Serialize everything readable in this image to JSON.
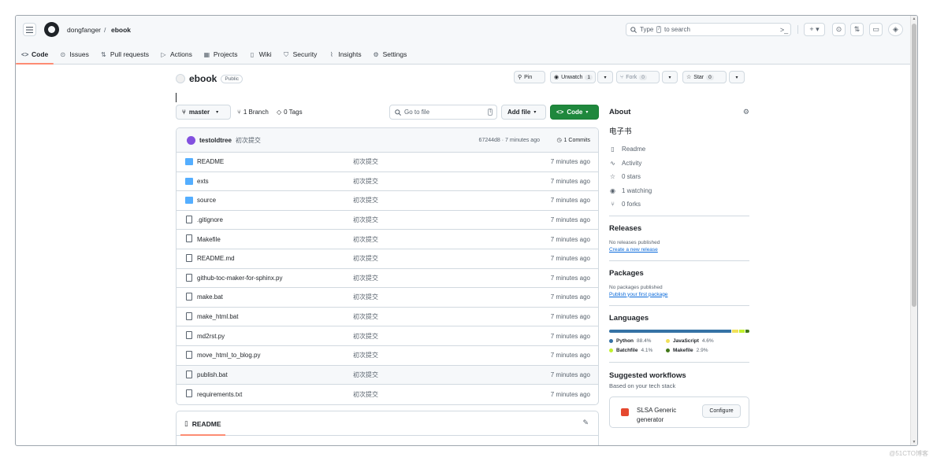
{
  "header": {
    "owner": "dongfanger",
    "separator": "/",
    "repo": "ebook",
    "search_prefix": "Type",
    "search_key": "/",
    "search_suffix": "to search"
  },
  "tabs": [
    {
      "label": "Code",
      "icon": "code-icon",
      "active": true
    },
    {
      "label": "Issues",
      "icon": "issue-icon"
    },
    {
      "label": "Pull requests",
      "icon": "pull-request-icon"
    },
    {
      "label": "Actions",
      "icon": "play-icon"
    },
    {
      "label": "Projects",
      "icon": "table-icon"
    },
    {
      "label": "Wiki",
      "icon": "book-icon"
    },
    {
      "label": "Security",
      "icon": "shield-icon"
    },
    {
      "label": "Insights",
      "icon": "graph-icon"
    },
    {
      "label": "Settings",
      "icon": "gear-icon"
    }
  ],
  "repo_header": {
    "name": "ebook",
    "visibility": "Public",
    "pin_label": "Pin",
    "unwatch_label": "Unwatch",
    "unwatch_count": "1",
    "fork_label": "Fork",
    "fork_count": "0",
    "star_label": "Star",
    "star_count": "0"
  },
  "toolbar": {
    "branch": "master",
    "branch_count": "1 Branch",
    "tag_count": "0 Tags",
    "goto_placeholder": "Go to file",
    "goto_key": "t",
    "add_file": "Add file",
    "code": "Code"
  },
  "commit": {
    "author": "testoldtree",
    "message": "初次提交",
    "sha_time": "67244d8 · 7 minutes ago",
    "commits": "1 Commits"
  },
  "files": [
    {
      "name": "README",
      "type": "dir",
      "msg": "初次提交",
      "time": "7 minutes ago"
    },
    {
      "name": "exts",
      "type": "dir",
      "msg": "初次提交",
      "time": "7 minutes ago"
    },
    {
      "name": "source",
      "type": "dir",
      "msg": "初次提交",
      "time": "7 minutes ago"
    },
    {
      "name": ".gitignore",
      "type": "file",
      "msg": "初次提交",
      "time": "7 minutes ago"
    },
    {
      "name": "Makefile",
      "type": "file",
      "msg": "初次提交",
      "time": "7 minutes ago"
    },
    {
      "name": "README.md",
      "type": "file",
      "msg": "初次提交",
      "time": "7 minutes ago"
    },
    {
      "name": "github-toc-maker-for-sphinx.py",
      "type": "file",
      "msg": "初次提交",
      "time": "7 minutes ago"
    },
    {
      "name": "make.bat",
      "type": "file",
      "msg": "初次提交",
      "time": "7 minutes ago"
    },
    {
      "name": "make_html.bat",
      "type": "file",
      "msg": "初次提交",
      "time": "7 minutes ago"
    },
    {
      "name": "md2rst.py",
      "type": "file",
      "msg": "初次提交",
      "time": "7 minutes ago"
    },
    {
      "name": "move_html_to_blog.py",
      "type": "file",
      "msg": "初次提交",
      "time": "7 minutes ago"
    },
    {
      "name": "publish.bat",
      "type": "file",
      "msg": "初次提交",
      "time": "7 minutes ago",
      "highlight": true
    },
    {
      "name": "requirements.txt",
      "type": "file",
      "msg": "初次提交",
      "time": "7 minutes ago"
    }
  ],
  "readme": {
    "label": "README"
  },
  "about": {
    "title": "About",
    "description": "电子书",
    "links": [
      {
        "label": "Readme",
        "icon": "book-icon"
      },
      {
        "label": "Activity",
        "icon": "pulse-icon"
      },
      {
        "label": "0 stars",
        "icon": "star-icon"
      },
      {
        "label": "1 watching",
        "icon": "eye-icon"
      },
      {
        "label": "0 forks",
        "icon": "fork-icon"
      }
    ]
  },
  "releases": {
    "title": "Releases",
    "none": "No releases published",
    "link": "Create a new release"
  },
  "packages": {
    "title": "Packages",
    "none": "No packages published",
    "link": "Publish your first package"
  },
  "languages": {
    "title": "Languages",
    "items": [
      {
        "name": "Python",
        "pct": "88.4%",
        "value": 88.4,
        "color": "#3572A5"
      },
      {
        "name": "JavaScript",
        "pct": "4.6%",
        "value": 4.6,
        "color": "#f1e05a"
      },
      {
        "name": "Batchfile",
        "pct": "4.1%",
        "value": 4.1,
        "color": "#C1F12E"
      },
      {
        "name": "Makefile",
        "pct": "2.9%",
        "value": 2.9,
        "color": "#427819"
      }
    ]
  },
  "workflows": {
    "title": "Suggested workflows",
    "subtitle": "Based on your tech stack",
    "card_name": "SLSA Generic generator",
    "configure": "Configure"
  },
  "watermark": "@51CTO博客"
}
